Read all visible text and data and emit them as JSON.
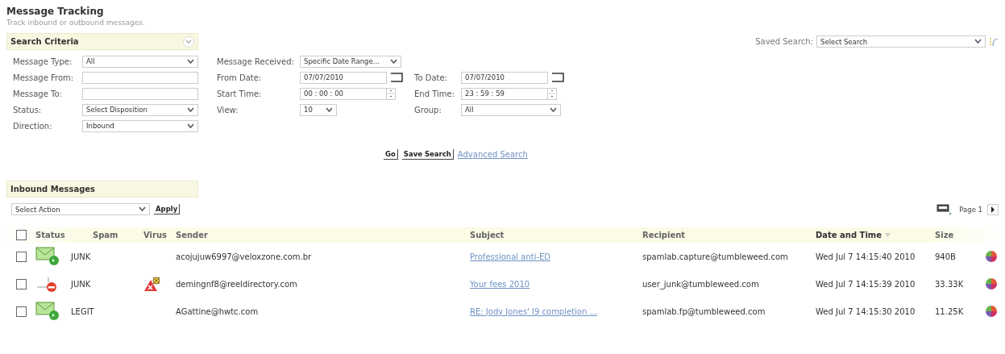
{
  "page": {
    "title": "Message Tracking",
    "subtitle": "Track inbound or outbound messages."
  },
  "search_criteria": {
    "title": "Search Criteria",
    "expanded": true,
    "columns": [
      [
        {
          "kind": "select",
          "label": "Message Type:",
          "value": "All"
        },
        {
          "kind": "text",
          "label": "Message From:"
        },
        {
          "kind": "text",
          "label": "Message To:"
        },
        {
          "kind": "select",
          "label": "Status:",
          "value": "Select Disposition"
        },
        {
          "kind": "select",
          "label": "Direction:",
          "value": "Inbound"
        }
      ],
      [
        {
          "kind": "select",
          "label": "Message Received:",
          "value": "Specific Date Range..."
        },
        {
          "kind": "date",
          "label": "From Date:",
          "value": "07/07/2010"
        },
        {
          "kind": "time",
          "label": "Start Time:",
          "value": "00 : 00 : 00"
        },
        {
          "kind": "select",
          "label": "View:",
          "value": "10"
        }
      ],
      [
        {
          "kind": "date",
          "label": "To Date:",
          "value": "07/07/2010"
        },
        {
          "kind": "time",
          "label": "End Time:",
          "value": "23 : 59 : 59"
        },
        {
          "kind": "select",
          "label": "Group:",
          "value": "All"
        }
      ]
    ],
    "buttons": [
      "Go",
      "Save Search"
    ],
    "link": "Advanced Search"
  },
  "saved_search": {
    "label": "Saved Search:",
    "value": "Select Search"
  },
  "messages": {
    "title": "Inbound Messages",
    "action": {
      "value": "Select Action",
      "button": "Apply"
    },
    "pager": {
      "label": "Page 1"
    },
    "columns": [
      "Status",
      "Spam",
      "Virus",
      "Sender",
      "Subject",
      "Recipient",
      "Date and Time",
      "Size"
    ],
    "select_all_checked": false,
    "rows": [
      {
        "checked": false,
        "kind": "delivered",
        "spam": "JUNK",
        "virus": false,
        "sender": "acojujuw6997@veloxzone.com.br",
        "subject": "Professional anti-ED",
        "recipient": "spamlab.capture@tumbleweed.com",
        "date": "Wed Jul 7 14:15:40 2010",
        "size": "940B"
      },
      {
        "checked": false,
        "kind": "blocked",
        "spam": "JUNK",
        "virus": true,
        "sender": "demingnf8@reeldirectory.com",
        "subject": "Your fees 2010",
        "recipient": "user_junk@tumbleweed.com",
        "date": "Wed Jul 7 14:15:39 2010",
        "size": "33.33K"
      },
      {
        "checked": false,
        "kind": "delivered",
        "spam": "LEGIT",
        "virus": false,
        "sender": "AGattine@hwtc.com",
        "subject": "RE: Jody Jones' I9 completion ...",
        "recipient": "spamlab.fp@tumbleweed.com",
        "date": "Wed Jul 7 14:15:30 2010",
        "size": "11.25K"
      }
    ]
  }
}
